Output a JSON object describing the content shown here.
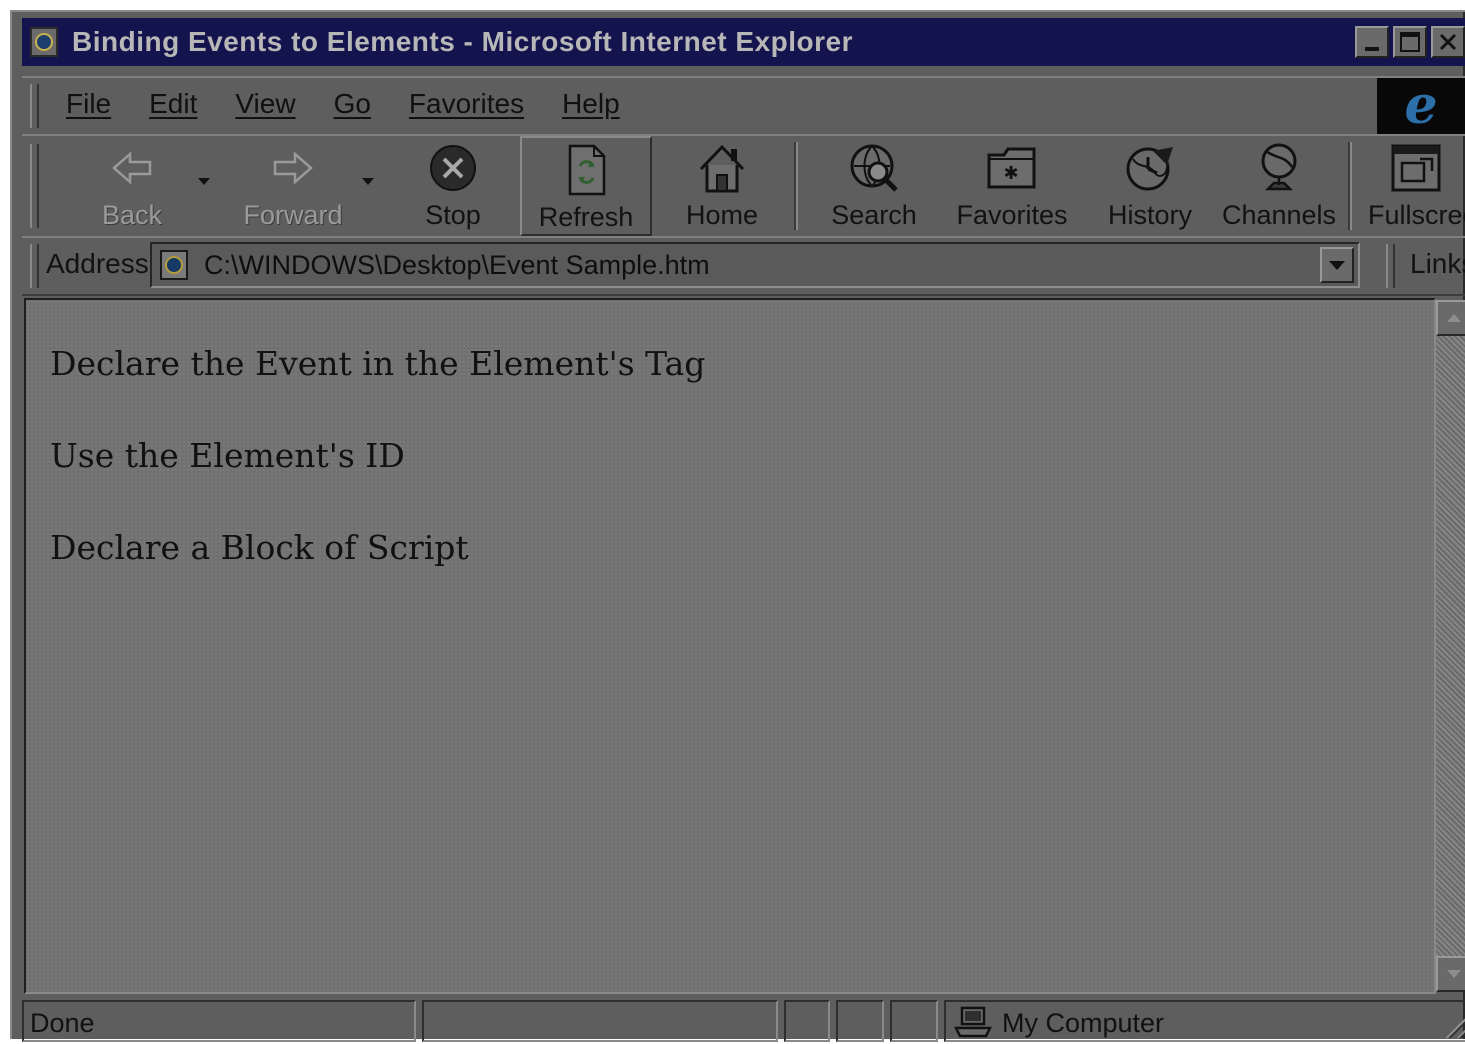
{
  "window": {
    "title": "Binding Events to Elements - Microsoft Internet Explorer",
    "controls": [
      "minimize",
      "maximize",
      "close"
    ]
  },
  "menubar": {
    "items": [
      "File",
      "Edit",
      "View",
      "Go",
      "Favorites",
      "Help"
    ]
  },
  "toolbar": {
    "buttons": [
      {
        "label": "Back",
        "icon": "back-arrow-icon",
        "state": "disabled"
      },
      {
        "label": "Forward",
        "icon": "forward-arrow-icon",
        "state": "disabled"
      },
      {
        "label": "Stop",
        "icon": "stop-icon",
        "state": "normal"
      },
      {
        "label": "Refresh",
        "icon": "refresh-icon",
        "state": "pressed"
      },
      {
        "label": "Home",
        "icon": "home-icon",
        "state": "normal"
      },
      {
        "label": "Search",
        "icon": "search-globe-icon",
        "state": "normal"
      },
      {
        "label": "Favorites",
        "icon": "favorites-folder-icon",
        "state": "normal"
      },
      {
        "label": "History",
        "icon": "history-icon",
        "state": "normal"
      },
      {
        "label": "Channels",
        "icon": "channels-satellite-icon",
        "state": "normal"
      },
      {
        "label": "Fullscree",
        "icon": "fullscreen-icon",
        "state": "normal"
      }
    ]
  },
  "address": {
    "label": "Address",
    "value": "C:\\WINDOWS\\Desktop\\Event Sample.htm",
    "links_label": "Links"
  },
  "content": {
    "paragraphs": [
      "Declare the Event in the Element's Tag",
      "Use the Element's ID",
      "Declare a Block of Script"
    ]
  },
  "status": {
    "text": "Done",
    "zone": "My Computer"
  }
}
